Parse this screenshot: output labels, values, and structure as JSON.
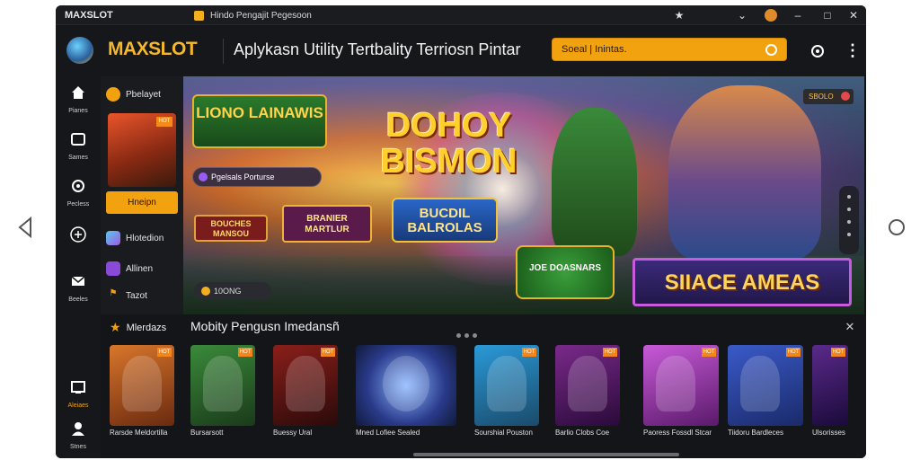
{
  "window": {
    "brand": "MAXSLOT",
    "tab_title": "Hindo Pengajit Pegesoon"
  },
  "header": {
    "logo": "MAXSLOT",
    "title": "Aplykasn Utility Tertbality Terriosn Pintar",
    "search_placeholder": "Soeal | Inintas."
  },
  "rail": {
    "items": [
      {
        "label": "Pianes",
        "icon": "home-icon"
      },
      {
        "label": "Sames",
        "icon": "games-icon"
      },
      {
        "label": "Pecless",
        "icon": "target-icon"
      },
      {
        "label": "",
        "icon": "shield-icon"
      },
      {
        "label": "Beeles",
        "icon": "mail-icon"
      },
      {
        "label": "Aleiaes",
        "icon": "screen-icon"
      },
      {
        "label": "Stnes",
        "icon": "user-icon"
      }
    ]
  },
  "categories": {
    "header": "Pbelayet",
    "active": "Hneipn",
    "hot_badge": "HOT"
  },
  "left_list": [
    {
      "label": "Hlotedion"
    },
    {
      "label": "Allinen"
    },
    {
      "label": "Tazot"
    }
  ],
  "hero": {
    "art1": "LIONO LAINAWIS",
    "art2": "DOHOY BISMON",
    "pill": "Pgelsals  Porturse",
    "art3": "BOUCHES MANSOU",
    "art4": "BRANIER MARTLUR",
    "art5": "BUCDIL BALROLAS",
    "art6": "JOE DOASNARS",
    "art7": "SIIACE AMEAS",
    "tag": "SBOLO",
    "mini_search": "10ONG"
  },
  "featured": {
    "label": "Mlerdazs",
    "section_title": "Mobity Pengusn Imedansñ",
    "games": [
      {
        "name": "Rarsde Meldortilla",
        "badge": "HOT",
        "color": "#d9762b"
      },
      {
        "name": "Bursarsott",
        "badge": "HOT",
        "color": "#3a8a3a"
      },
      {
        "name": "Buessy Ural",
        "badge": "HOT",
        "color": "#8a1f1a"
      },
      {
        "name": "Mned Lofiee Sealed",
        "badge": "",
        "color": "#2a3a8a"
      },
      {
        "name": "Sourshial Pouston",
        "badge": "HOT",
        "color": "#2a9ad8"
      },
      {
        "name": "Barlio Clobs Coe",
        "badge": "HOT",
        "color": "#7a2a8a"
      },
      {
        "name": "Paoress Fossdl Stcar",
        "badge": "HOT",
        "color": "#c85ad8"
      },
      {
        "name": "Tiidoru Bardleces",
        "badge": "HOT",
        "color": "#3a5ac8"
      },
      {
        "name": "Ulsorisses",
        "badge": "HOT",
        "color": "#5a2a8a"
      }
    ]
  },
  "colors": {
    "accent": "#f2a10f",
    "bg": "#121316"
  }
}
